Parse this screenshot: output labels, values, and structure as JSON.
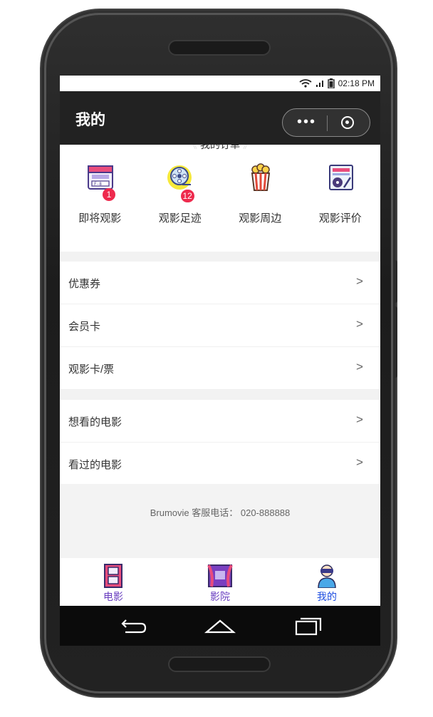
{
  "status_bar": {
    "time": "02:18 PM"
  },
  "nav": {
    "title": "我的"
  },
  "orders": {
    "header": "我的订单",
    "items": [
      {
        "label": "即将观影",
        "badge": "1",
        "icon": "calendar-ticket-icon"
      },
      {
        "label": "观影足迹",
        "badge": "12",
        "icon": "film-reel-icon"
      },
      {
        "label": "观影周边",
        "badge": "",
        "icon": "popcorn-icon"
      },
      {
        "label": "观影评价",
        "badge": "",
        "icon": "review-notebook-icon"
      }
    ]
  },
  "menu": {
    "group1": [
      {
        "label": "优惠券",
        "arrow": ">"
      },
      {
        "label": "会员卡",
        "arrow": ">"
      },
      {
        "label": "观影卡/票",
        "arrow": ">"
      }
    ],
    "group2": [
      {
        "label": "想看的电影",
        "arrow": ">"
      },
      {
        "label": "看过的电影",
        "arrow": ">"
      }
    ]
  },
  "footer": {
    "service": "Brumovie 客服电话：  020-888888"
  },
  "tabs": [
    {
      "label": "电影",
      "icon": "film-strip-icon"
    },
    {
      "label": "影院",
      "icon": "theater-icon"
    },
    {
      "label": "我的",
      "icon": "user-vr-icon",
      "active": true
    }
  ],
  "colors": {
    "nav_bg": "#222222",
    "badge": "#ee2a4d",
    "tab_text": "#6a3fc0",
    "tab_active": "#1f4ee0"
  }
}
